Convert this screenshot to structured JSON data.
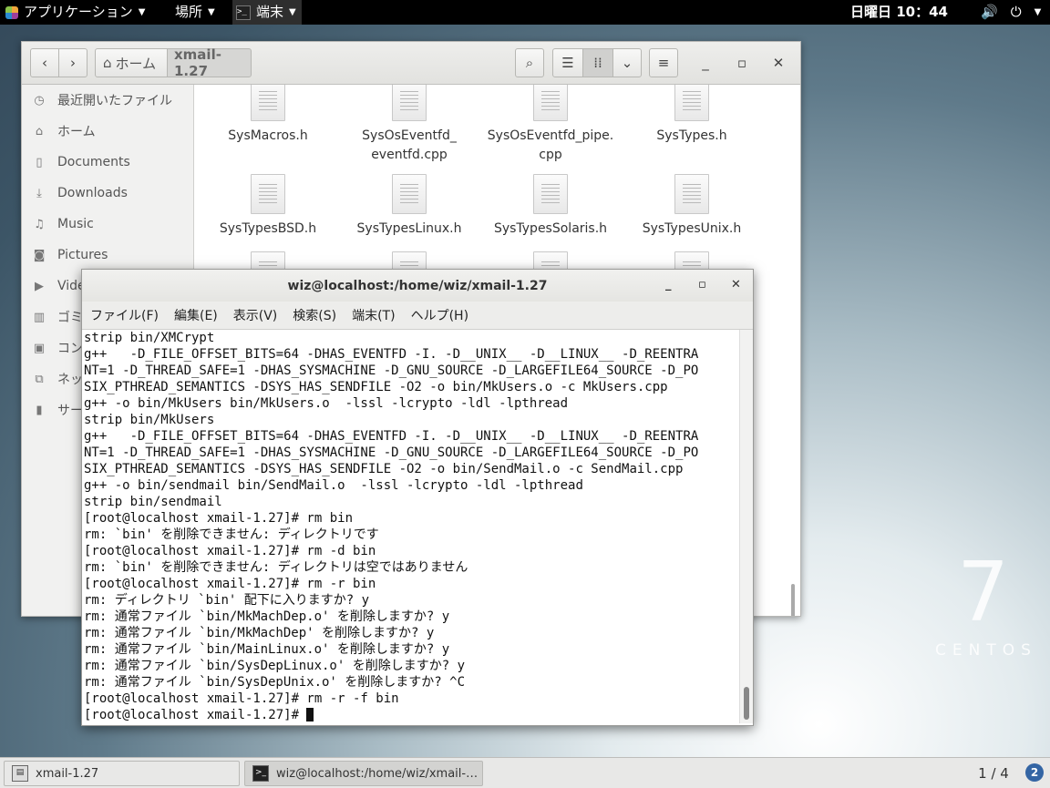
{
  "top_panel": {
    "apps_label": "アプリケーション",
    "places_label": "場所",
    "terminal_label": "端末",
    "clock": "日曜日 10：44"
  },
  "file_manager": {
    "breadcrumb_home": "ホーム",
    "breadcrumb_current": "xmail-1.27",
    "sidebar": [
      {
        "label": "最近開いたファイル",
        "icon": "clock-icon"
      },
      {
        "label": "ホーム",
        "icon": "home-icon"
      },
      {
        "label": "Documents",
        "icon": "document-icon"
      },
      {
        "label": "Downloads",
        "icon": "download-icon"
      },
      {
        "label": "Music",
        "icon": "music-icon"
      },
      {
        "label": "Pictures",
        "icon": "camera-icon"
      },
      {
        "label": "Vide",
        "icon": "video-icon"
      },
      {
        "label": "ゴミ",
        "icon": "trash-icon"
      },
      {
        "label": "コン",
        "icon": "computer-icon"
      },
      {
        "label": "ネッ",
        "icon": "network-icon"
      },
      {
        "label": "サー",
        "icon": "server-icon"
      }
    ],
    "files": [
      {
        "name": "SysMacros.h"
      },
      {
        "name": "SysOsEventfd_\neventfd.cpp"
      },
      {
        "name": "SysOsEventfd_pipe.\ncpp"
      },
      {
        "name": "SysTypes.h"
      },
      {
        "name": "SysTypesBSD.h"
      },
      {
        "name": "SysTypesLinux.h"
      },
      {
        "name": "SysTypesSolaris.h"
      },
      {
        "name": "SysTypesUnix.h"
      }
    ]
  },
  "terminal": {
    "title": "wiz@localhost:/home/wiz/xmail-1.27",
    "menu": [
      "ファイル(F)",
      "編集(E)",
      "表示(V)",
      "検索(S)",
      "端末(T)",
      "ヘルプ(H)"
    ],
    "lines": [
      "strip bin/XMCrypt",
      "g++   -D_FILE_OFFSET_BITS=64 -DHAS_EVENTFD -I. -D__UNIX__ -D__LINUX__ -D_REENTRA",
      "NT=1 -D_THREAD_SAFE=1 -DHAS_SYSMACHINE -D_GNU_SOURCE -D_LARGEFILE64_SOURCE -D_PO",
      "SIX_PTHREAD_SEMANTICS -DSYS_HAS_SENDFILE -O2 -o bin/MkUsers.o -c MkUsers.cpp",
      "g++ -o bin/MkUsers bin/MkUsers.o  -lssl -lcrypto -ldl -lpthread",
      "strip bin/MkUsers",
      "g++   -D_FILE_OFFSET_BITS=64 -DHAS_EVENTFD -I. -D__UNIX__ -D__LINUX__ -D_REENTRA",
      "NT=1 -D_THREAD_SAFE=1 -DHAS_SYSMACHINE -D_GNU_SOURCE -D_LARGEFILE64_SOURCE -D_PO",
      "SIX_PTHREAD_SEMANTICS -DSYS_HAS_SENDFILE -O2 -o bin/SendMail.o -c SendMail.cpp",
      "g++ -o bin/sendmail bin/SendMail.o  -lssl -lcrypto -ldl -lpthread",
      "strip bin/sendmail",
      "[root@localhost xmail-1.27]# rm bin",
      "rm: `bin' を削除できません: ディレクトリです",
      "[root@localhost xmail-1.27]# rm -d bin",
      "rm: `bin' を削除できません: ディレクトリは空ではありません",
      "[root@localhost xmail-1.27]# rm -r bin",
      "rm: ディレクトリ `bin' 配下に入りますか? y",
      "rm: 通常ファイル `bin/MkMachDep.o' を削除しますか? y",
      "rm: 通常ファイル `bin/MkMachDep' を削除しますか? y",
      "rm: 通常ファイル `bin/MainLinux.o' を削除しますか? y",
      "rm: 通常ファイル `bin/SysDepLinux.o' を削除しますか? y",
      "rm: 通常ファイル `bin/SysDepUnix.o' を削除しますか? ^C",
      "[root@localhost xmail-1.27]# rm -r -f bin",
      "[root@localhost xmail-1.27]# "
    ]
  },
  "watermark": {
    "number": "7",
    "word": "CENTOS"
  },
  "taskbar": {
    "tasks": [
      {
        "label": "xmail-1.27"
      },
      {
        "label": "wiz@localhost:/home/wiz/xmail-…"
      }
    ],
    "workspace": "1 / 4",
    "notification_count": "2"
  }
}
